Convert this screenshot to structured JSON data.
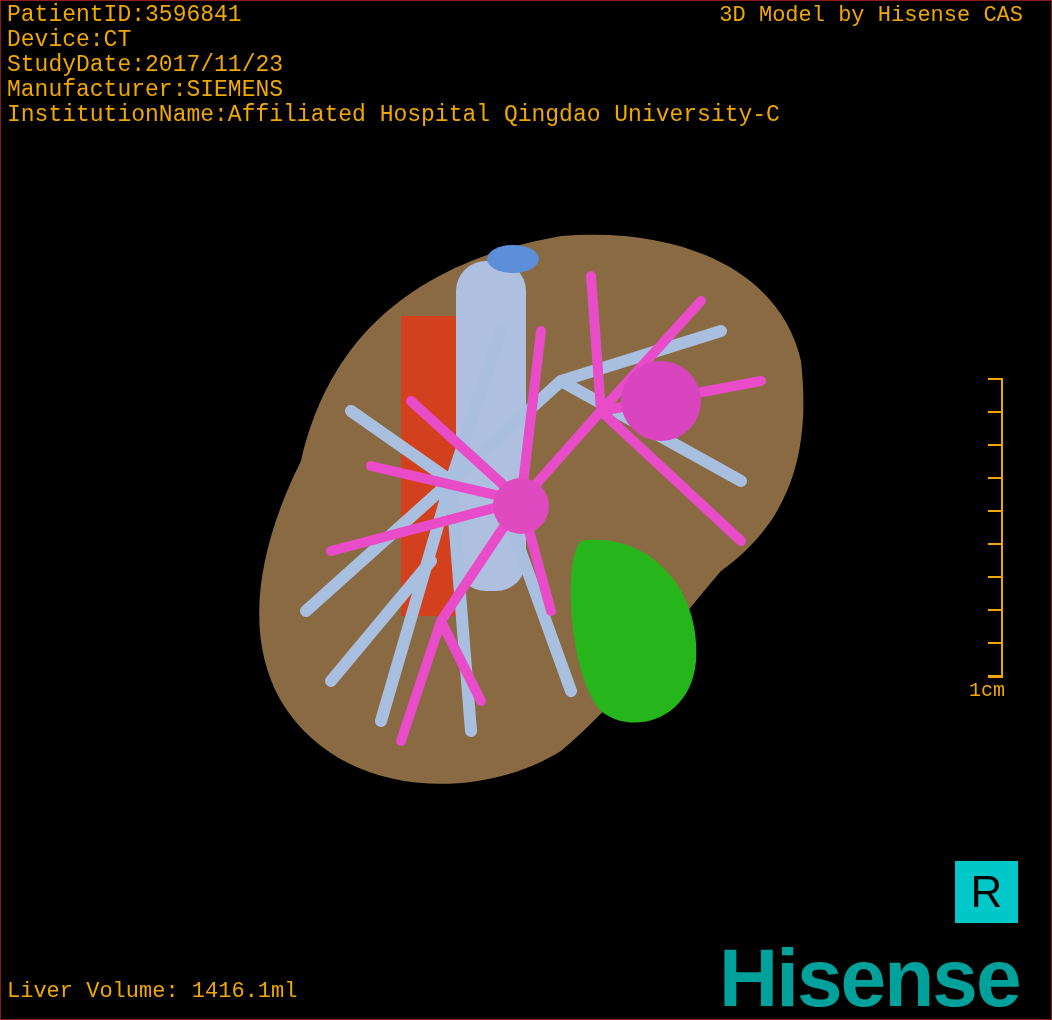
{
  "info_lines": [
    "PatientID:3596841",
    "Device:CT",
    "StudyDate:2017/11/23",
    "Manufacturer:SIEMENS",
    "InstitutionName:Affiliated Hospital Qingdao University-C"
  ],
  "model_credit": "3D Model by Hisense CAS",
  "scale_bar": {
    "label": "1cm"
  },
  "orientation_marker": "R",
  "liver_volume": "Liver Volume: 1416.1ml",
  "logo": "Hisense"
}
